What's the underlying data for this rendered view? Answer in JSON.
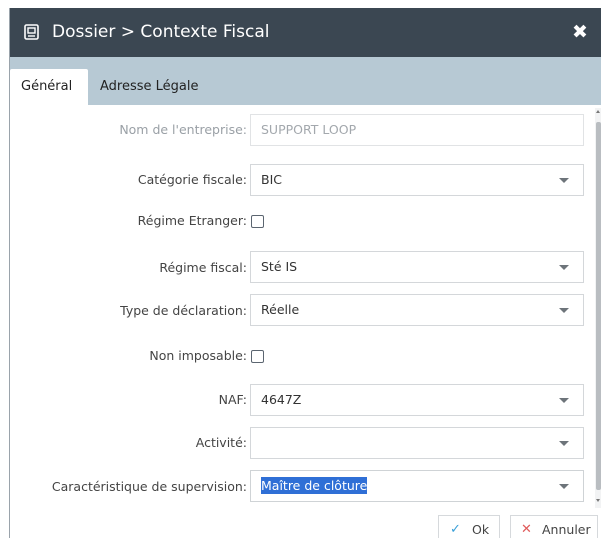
{
  "window": {
    "title": "Dossier > Contexte Fiscal",
    "title_icon": "dossier-icon",
    "close_icon": "close-icon",
    "close_glyph": "✖"
  },
  "tabs": [
    {
      "label": "Général",
      "active": true
    },
    {
      "label": "Adresse Légale",
      "active": false
    }
  ],
  "form": {
    "entreprise": {
      "label": "Nom de l'entreprise:",
      "value": "SUPPORT LOOP",
      "disabled": true
    },
    "categorie": {
      "label": "Catégorie fiscale:",
      "value": "BIC"
    },
    "regime_etranger": {
      "label": "Régime Etranger:",
      "checked": false
    },
    "regime_fiscal": {
      "label": "Régime fiscal:",
      "value": "Sté IS"
    },
    "type_declaration": {
      "label": "Type de déclaration:",
      "value": "Réelle"
    },
    "non_imposable": {
      "label": "Non imposable:",
      "checked": false
    },
    "naf": {
      "label": "NAF:",
      "value": "4647Z"
    },
    "activite": {
      "label": "Activité:",
      "value": ""
    },
    "supervision": {
      "label": "Caractéristique de supervision:",
      "value": "Maître de clôture",
      "text_selected": true
    }
  },
  "buttons": {
    "ok": {
      "label": "Ok",
      "icon": "check-icon",
      "glyph": "✓",
      "glyph_color": "#3aa0d8"
    },
    "cancel": {
      "label": "Annuler",
      "icon": "cross-icon",
      "glyph": "✕",
      "glyph_color": "#e05a5a"
    }
  },
  "colors": {
    "titlebar_bg": "#3b4752",
    "tabbar_bg": "#b7c9d4",
    "selection": "#2f6fd6"
  }
}
